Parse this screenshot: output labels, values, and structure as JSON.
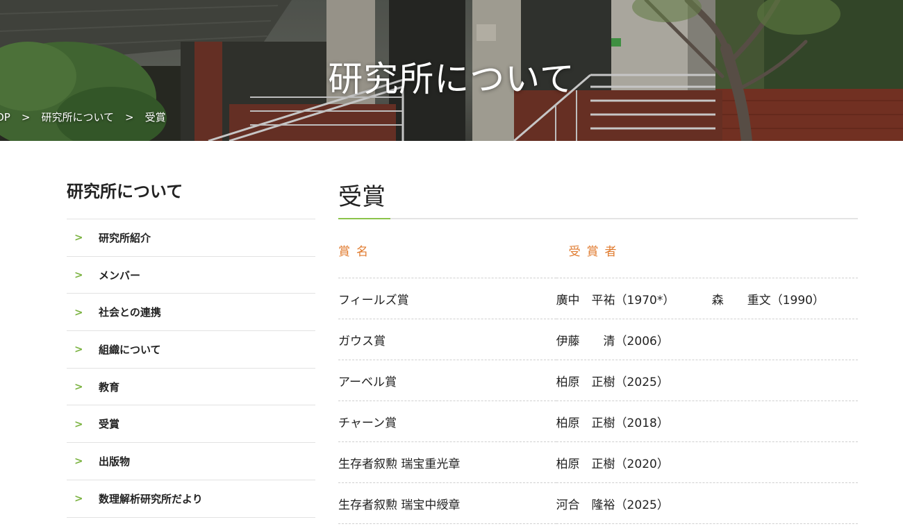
{
  "hero": {
    "title": "研究所について"
  },
  "breadcrumb": {
    "items": [
      "OP",
      "研究所について",
      "受賞"
    ],
    "separator": ">"
  },
  "sidebar": {
    "title": "研究所について",
    "chevron": ">",
    "items": [
      {
        "label": "研究所紹介"
      },
      {
        "label": "メンバー"
      },
      {
        "label": "社会との連携"
      },
      {
        "label": "組織について"
      },
      {
        "label": "教育"
      },
      {
        "label": "受賞"
      },
      {
        "label": "出版物"
      },
      {
        "label": "数理解析研究所だより"
      }
    ]
  },
  "main": {
    "title": "受賞",
    "table": {
      "headers": [
        "賞名",
        "受賞者"
      ],
      "rows": [
        {
          "award": "フィールズ賞",
          "recipients": [
            "廣中　平祐（1970*）",
            "森　　重文（1990）"
          ]
        },
        {
          "award": "ガウス賞",
          "recipients": [
            "伊藤　　清（2006）"
          ]
        },
        {
          "award": "アーベル賞",
          "recipients": [
            "柏原　正樹（2025）"
          ]
        },
        {
          "award": "チャーン賞",
          "recipients": [
            "柏原　正樹（2018）"
          ]
        },
        {
          "award": "生存者叙勲 瑞宝重光章",
          "recipients": [
            "柏原　正樹（2020）"
          ]
        },
        {
          "award": "生存者叙勲 瑞宝中綬章",
          "recipients": [
            "河合　隆裕（2025）"
          ]
        }
      ]
    }
  },
  "colors": {
    "accent_green": "#8bc34a",
    "header_orange": "#e07a2d",
    "text": "#222222"
  }
}
